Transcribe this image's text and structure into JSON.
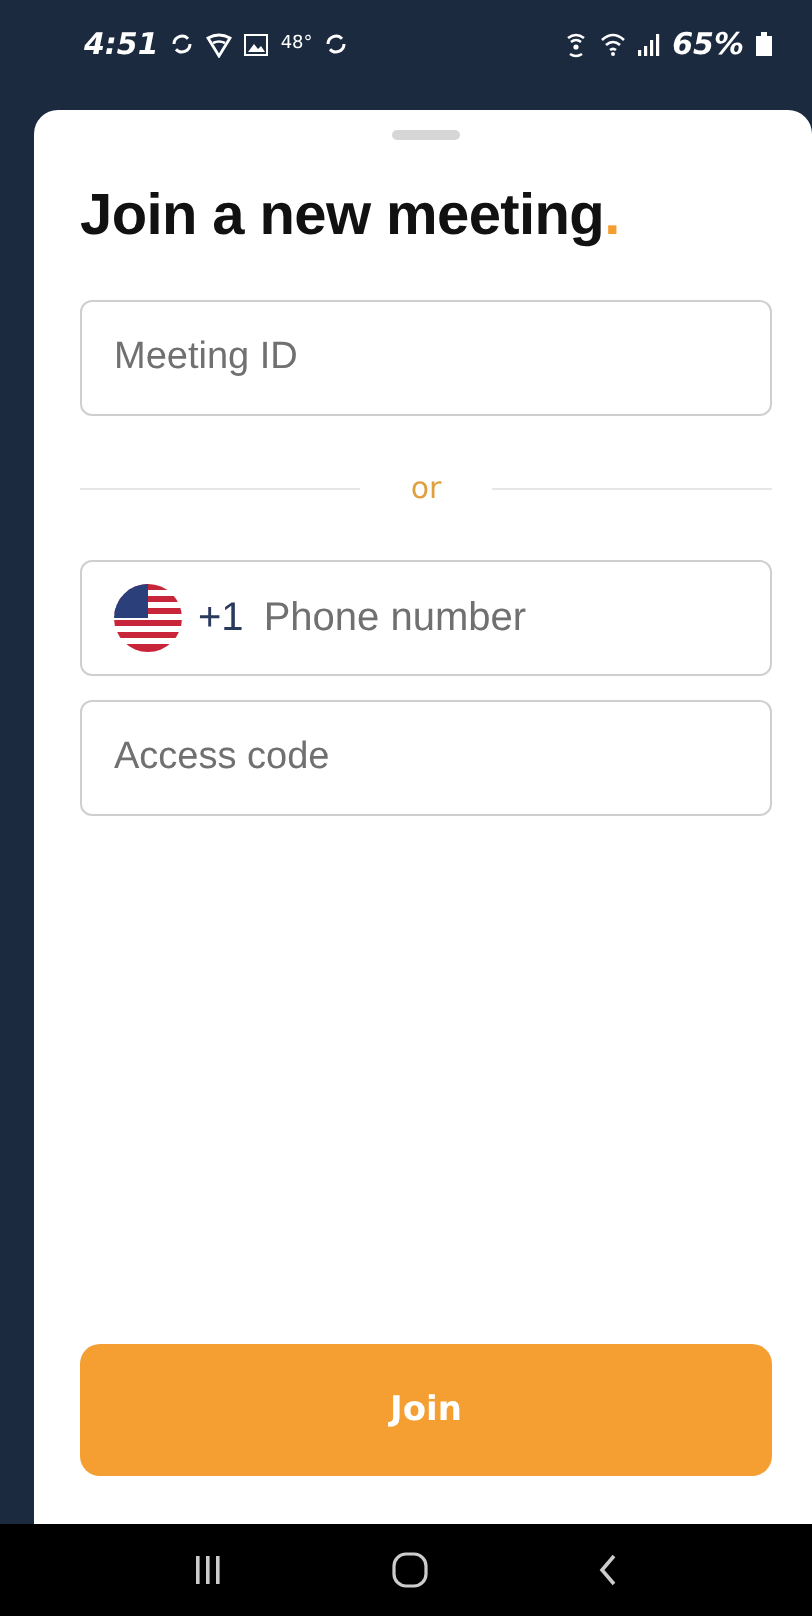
{
  "status_bar": {
    "time": "4:51",
    "temperature": "48°",
    "battery": "65%"
  },
  "sheet": {
    "title": "Join a new meeting",
    "title_accent": ".",
    "meeting_id": {
      "placeholder": "Meeting ID"
    },
    "divider": "or",
    "phone": {
      "country_code": "+1",
      "placeholder": "Phone number"
    },
    "access_code": {
      "placeholder": "Access code"
    },
    "join_button": "Join"
  }
}
